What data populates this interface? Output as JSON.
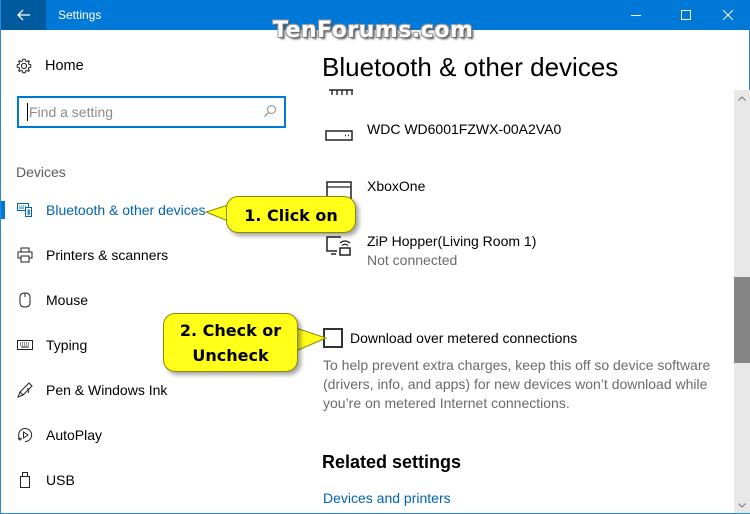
{
  "window": {
    "title": "Settings",
    "watermark": "TenForums.com",
    "controls": [
      "minimize",
      "maximize",
      "close"
    ]
  },
  "sidebar": {
    "home_label": "Home",
    "search": {
      "placeholder": "Find a setting",
      "value": ""
    },
    "section_label": "Devices",
    "items": [
      {
        "label": "Bluetooth & other devices",
        "icon": "bluetooth-devices-icon",
        "active": true
      },
      {
        "label": "Printers & scanners",
        "icon": "printer-icon",
        "active": false
      },
      {
        "label": "Mouse",
        "icon": "mouse-icon",
        "active": false
      },
      {
        "label": "Typing",
        "icon": "keyboard-icon",
        "active": false
      },
      {
        "label": "Pen & Windows Ink",
        "icon": "pen-icon",
        "active": false
      },
      {
        "label": "AutoPlay",
        "icon": "autoplay-icon",
        "active": false
      },
      {
        "label": "USB",
        "icon": "usb-icon",
        "active": false
      }
    ]
  },
  "main": {
    "page_title": "Bluetooth & other devices",
    "devices": [
      {
        "name": "WDC WD6001FZWX-00A2VA0",
        "status": "",
        "icon": "drive-icon"
      },
      {
        "name": "XboxOne",
        "status": "",
        "icon": "xbox-icon"
      },
      {
        "name": "ZiP Hopper(Living Room 1)",
        "status": "Not connected",
        "icon": "media-device-icon"
      }
    ],
    "metered": {
      "checkbox_label": "Download over metered connections",
      "checked": false,
      "help_text": "To help prevent extra charges, keep this off so device software (drivers, info, and apps) for new devices won’t download while you’re on metered Internet connections."
    },
    "related": {
      "title": "Related settings",
      "links": [
        "Devices and printers"
      ]
    }
  },
  "scroll": {
    "position_fraction": 0.56,
    "visible_fraction": 0.22
  },
  "annotations": {
    "callout_1": "1. Click on",
    "callout_2_line1": "2. Check or",
    "callout_2_line2": "Uncheck"
  },
  "colors": {
    "accent": "#0078d7",
    "back_button": "#005a9e",
    "link": "#0063b1",
    "callout": "#ffff1a"
  }
}
